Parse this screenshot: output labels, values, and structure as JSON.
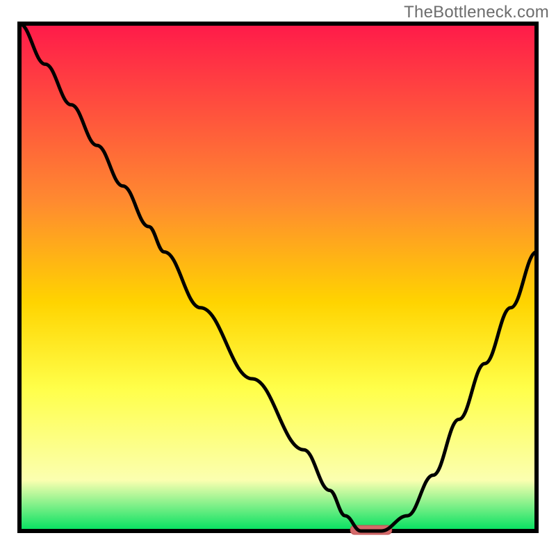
{
  "watermark": "TheBottleneck.com",
  "colors": {
    "gradient_top": "#ff1a4a",
    "gradient_mid1": "#ff8a30",
    "gradient_mid2": "#ffd400",
    "gradient_yellow": "#ffff4a",
    "gradient_pale": "#fbffb0",
    "gradient_green": "#00e060",
    "frame": "#000000",
    "curve": "#000000",
    "marker_fill": "#d46a6a",
    "marker_stroke": "#c05050"
  },
  "chart_data": {
    "type": "line",
    "title": "",
    "xlabel": "",
    "ylabel": "",
    "xlim": [
      0,
      100
    ],
    "ylim": [
      0,
      100
    ],
    "x": [
      0,
      5,
      10,
      15,
      20,
      25,
      28,
      35,
      45,
      55,
      60,
      63,
      66,
      70,
      75,
      80,
      85,
      90,
      95,
      100
    ],
    "values": [
      100,
      92,
      84,
      76,
      68,
      60,
      55,
      44,
      30,
      16,
      8,
      3,
      0,
      0,
      3,
      11,
      22,
      33,
      44,
      55
    ],
    "marker": {
      "x_start": 64,
      "x_end": 72,
      "y": 0
    },
    "notes": "V-shaped bottleneck curve over a red→yellow→green heatmap; minimum (0) sits near x≈66–70. Values are read approximately from pixel positions since the chart has no tick labels."
  }
}
